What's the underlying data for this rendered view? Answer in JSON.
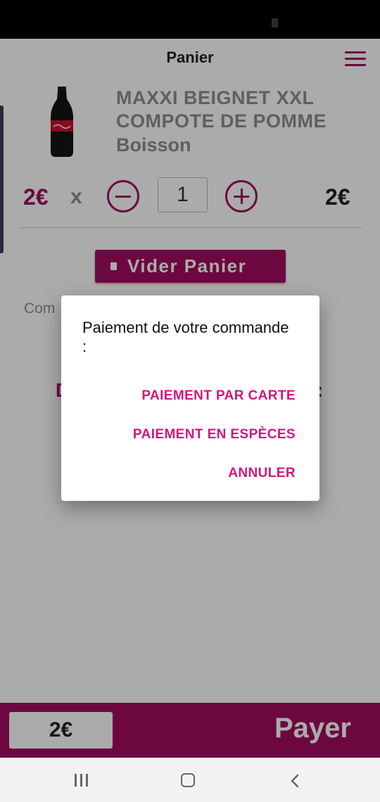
{
  "header": {
    "title": "Panier"
  },
  "cart_item": {
    "name": "MAXXI BEIGNET XXL COMPOTE DE POMME",
    "category": "Boisson",
    "unit_price": "2€",
    "times_sign": "x",
    "quantity": "1",
    "line_total": "2€"
  },
  "clear_cart_label": "Vider Panier",
  "comment_hint": "Com",
  "partial_text": {
    "left": "D",
    "right": ":"
  },
  "dialog": {
    "message": "Paiement de votre commande :",
    "actions": {
      "card": "PAIEMENT PAR CARTE",
      "cash": "PAIEMENT EN ESPÈCES",
      "cancel": "ANNULER"
    }
  },
  "bottom_bar": {
    "total": "2€",
    "pay_label": "Payer"
  },
  "colors": {
    "brand": "#a30b5e",
    "dialog_action": "#d4147f"
  },
  "icons": [
    "menu-icon",
    "minus-icon",
    "plus-icon",
    "trash-icon",
    "nav-recent-icon",
    "nav-home-icon",
    "nav-back-icon"
  ]
}
